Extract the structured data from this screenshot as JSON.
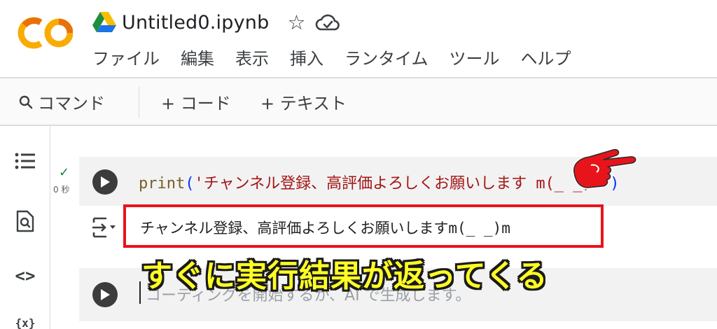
{
  "header": {
    "logo_text": "CO",
    "notebook_title": "Untitled0.ipynb",
    "menu": [
      "ファイル",
      "編集",
      "表示",
      "挿入",
      "ランタイム",
      "ツール",
      "ヘルプ"
    ]
  },
  "toolbar": {
    "command_label": "コマンド",
    "add_code_label": "+ コード",
    "add_text_label": "+ テキスト"
  },
  "sidebar": {
    "icons": [
      "table-of-contents-icon",
      "find-icon",
      "code-snippets-icon",
      "variables-icon"
    ],
    "code_symbol": "<>",
    "variables_symbol": "{x}"
  },
  "cells": {
    "code_cell": {
      "status_check": "✓",
      "exec_time": "0 秒",
      "func": "print",
      "open_paren": "(",
      "string": "'チャンネル登録、高評価よろしくお願いします m(_ _)m'",
      "close_paren": ")"
    },
    "output": {
      "text": "チャンネル登録、高評価よろしくお願いしますm(_ _)m"
    },
    "empty_cell": {
      "placeholder": "コーディングを開始するか、AI で生成します。"
    }
  },
  "annotation": {
    "caption": "すぐに実行結果が返ってくる"
  },
  "colors": {
    "highlight_border": "#e8141c",
    "caption_fill": "#ffff26",
    "logo_orange": "#f9ab00",
    "logo_dark_orange": "#e8710a"
  }
}
